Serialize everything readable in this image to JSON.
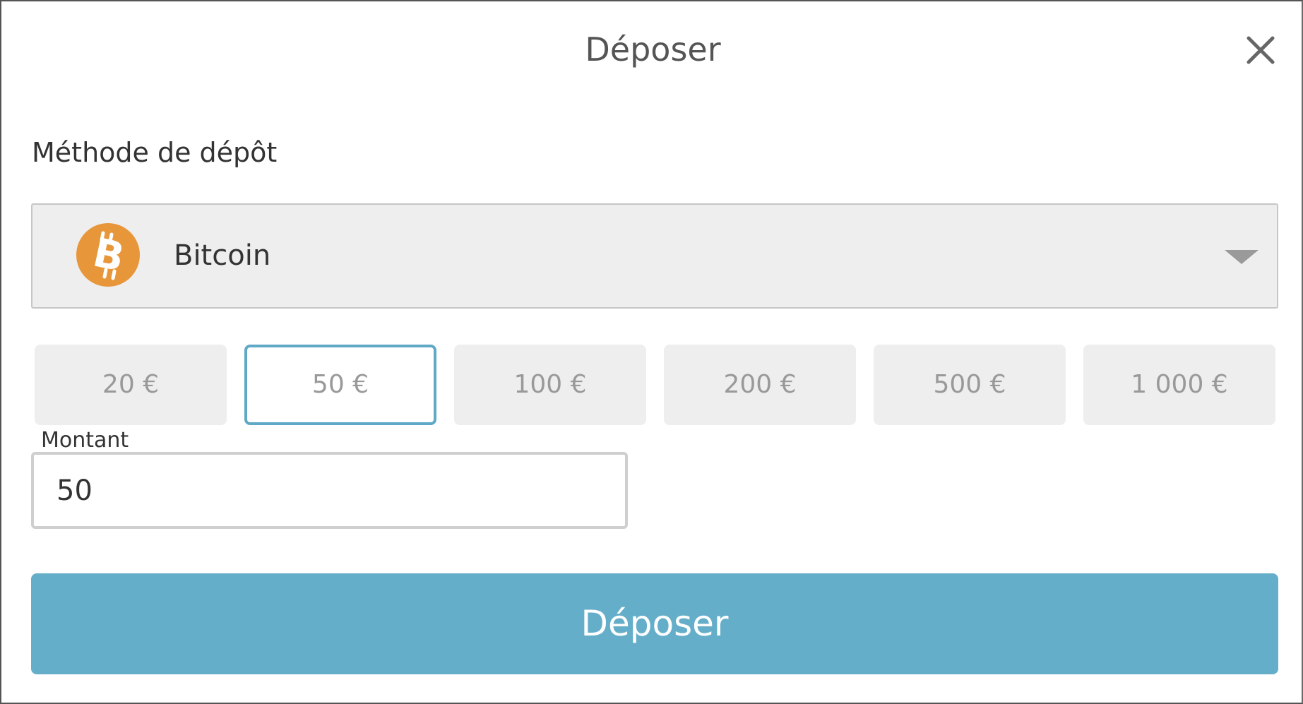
{
  "dialog": {
    "title": "Déposer",
    "close_icon": "close-icon"
  },
  "method": {
    "section_label": "Méthode de dépôt",
    "selected_label": "Bitcoin",
    "icon": "bitcoin-icon",
    "icon_color": "#E8963A",
    "chevron_icon": "chevron-down-icon"
  },
  "amounts": {
    "options": [
      "20 €",
      "50 €",
      "100 €",
      "200 €",
      "500 €",
      "1 000 €"
    ],
    "selected_index": 1
  },
  "amount_field": {
    "label": "Montant",
    "value": "50"
  },
  "submit": {
    "label": "Déposer"
  },
  "colors": {
    "accent": "#65AEC9",
    "selected_border": "#5FA9C6",
    "chip_background": "#EEEEEE"
  }
}
